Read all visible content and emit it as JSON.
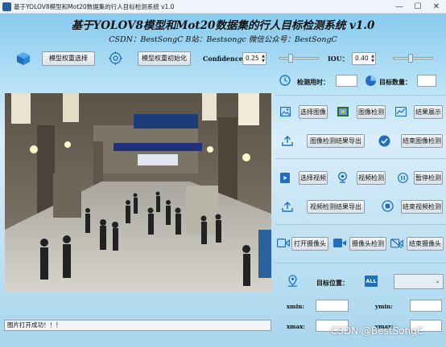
{
  "window": {
    "title": "基于YOLOV8模型和Mot20数据集的行人目标检测系统 v1.0",
    "controls": [
      "—",
      "☐",
      "✕"
    ]
  },
  "header": {
    "title": "基于YOLOV8模型和Mot20数据集的行人目标检测系统 v1.0",
    "subtitle": "CSDN：BestSongC   B站：Bestsongc   微信公众号：BestSongC"
  },
  "toolbar": {
    "select_weight_label": "模型权重选择",
    "init_weight_label": "模型权重初始化",
    "confidence_label": "Confidence:",
    "confidence_value": "0.25",
    "confidence_level": 0.25,
    "iou_label": "IOU：",
    "iou_value": "0.40",
    "iou_level": 0.4
  },
  "stats": {
    "time_label": "检测用时：",
    "time_value": "",
    "count_label": "目标数量：",
    "count_value": ""
  },
  "image_section": {
    "select_image_label": "选择图像",
    "detect_image_label": "图像检测",
    "show_result_label": "结果展示",
    "export_result_label": "图像检测结果导出",
    "end_detect_label": "结束图像检测"
  },
  "video_section": {
    "select_video_label": "选择视频",
    "detect_video_label": "视频检测",
    "pause_label": "暂停检测",
    "export_result_label": "视频检测结果导出",
    "end_detect_label": "结束视频检测"
  },
  "camera_section": {
    "open_camera_label": "打开摄像头",
    "detect_camera_label": "摄像头检测",
    "end_camera_label": "结束摄像头"
  },
  "target_section": {
    "position_label": "目标位置：",
    "all_badge": "ALL",
    "target_select_value": "",
    "xmin_label": "xmin:",
    "ymin_label": "ymin:",
    "xmax_label": "xmax:",
    "ymax_label": "ymax:"
  },
  "status": {
    "message": "图片打开成功！！！"
  },
  "watermark": "CSDN @BestSongC"
}
